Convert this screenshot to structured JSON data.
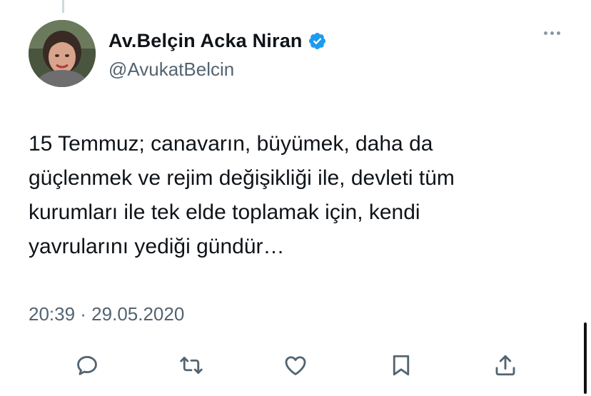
{
  "tweet": {
    "author_name": "Av.Belçin Acka Niran",
    "author_handle": "@AvukatBelcin",
    "verified": true,
    "text": "15 Temmuz; canavarın, büyümek, daha da\ngüçlenmek ve rejim değişikliği ile, devleti tüm\nkurumları ile tek elde toplamak için, kendi\nyavrularını yediği gündür…",
    "timestamp": "20:39 · 29.05.2020"
  },
  "icons": {
    "verified": "verified-badge-icon",
    "more": "more-options-icon",
    "reply": "reply-icon",
    "retweet": "retweet-icon",
    "like": "like-icon",
    "bookmark": "bookmark-icon",
    "share": "share-icon"
  },
  "colors": {
    "verified_blue": "#1d9bf0",
    "text": "#0f1419",
    "secondary": "#536471",
    "icon": "#536471"
  }
}
